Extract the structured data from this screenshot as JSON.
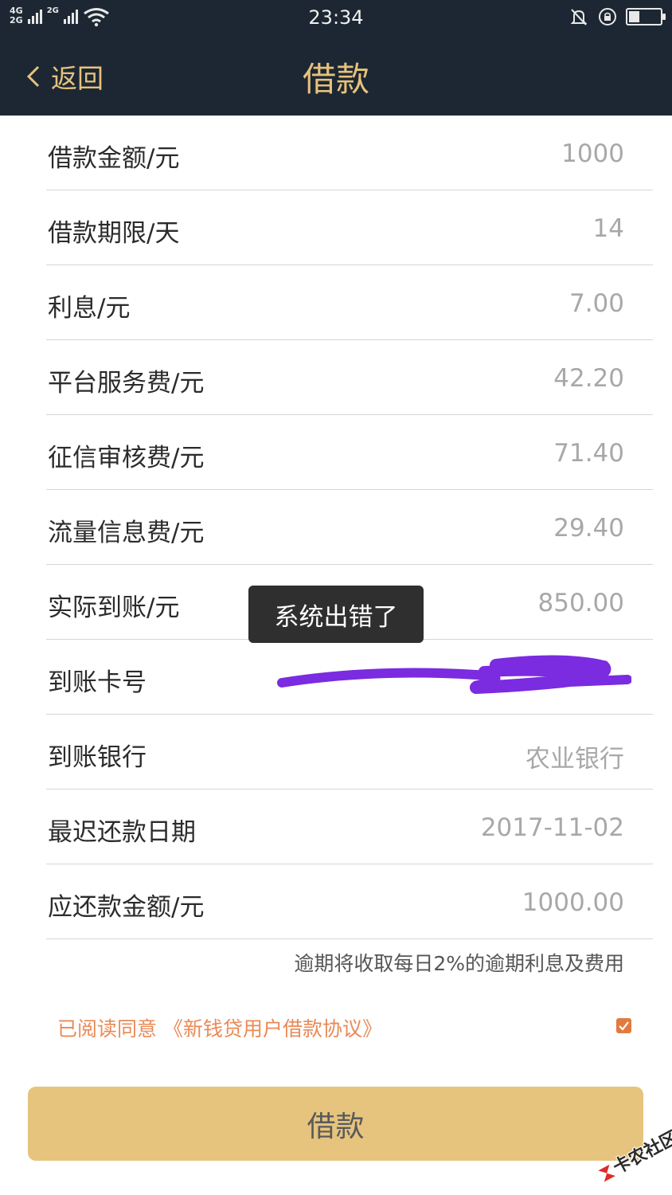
{
  "status_bar": {
    "net1": "4G",
    "net2": "2G",
    "net3": "2G",
    "time": "23:34",
    "battery_level": 0.35
  },
  "header": {
    "back_label": "返回",
    "title": "借款"
  },
  "rows": [
    {
      "label": "借款金额/元",
      "value": "1000"
    },
    {
      "label": "借款期限/天",
      "value": "14"
    },
    {
      "label": "利息/元",
      "value": "7.00"
    },
    {
      "label": "平台服务费/元",
      "value": "42.20"
    },
    {
      "label": "征信审核费/元",
      "value": "71.40"
    },
    {
      "label": "流量信息费/元",
      "value": "29.40"
    },
    {
      "label": "实际到账/元",
      "value": "850.00"
    },
    {
      "label": "到账卡号",
      "value": ""
    },
    {
      "label": "到账银行",
      "value": "农业银行"
    },
    {
      "label": "最迟还款日期",
      "value": "2017-11-02"
    },
    {
      "label": "应还款金额/元",
      "value": "1000.00"
    }
  ],
  "notice": "逾期将收取每日2%的逾期利息及费用",
  "agreement": {
    "text": "已阅读同意 《新钱贷用户借款协议》",
    "checked": true
  },
  "toast": "系统出错了",
  "submit_label": "借款",
  "watermark": "卡农社区",
  "colors": {
    "header_bg": "#1d2733",
    "accent_gold": "#e6c27c",
    "button_bg": "#e6c47e",
    "agreement_text": "#ea8a56",
    "checkbox": "#e27a3f",
    "redaction": "#7b2be0"
  }
}
